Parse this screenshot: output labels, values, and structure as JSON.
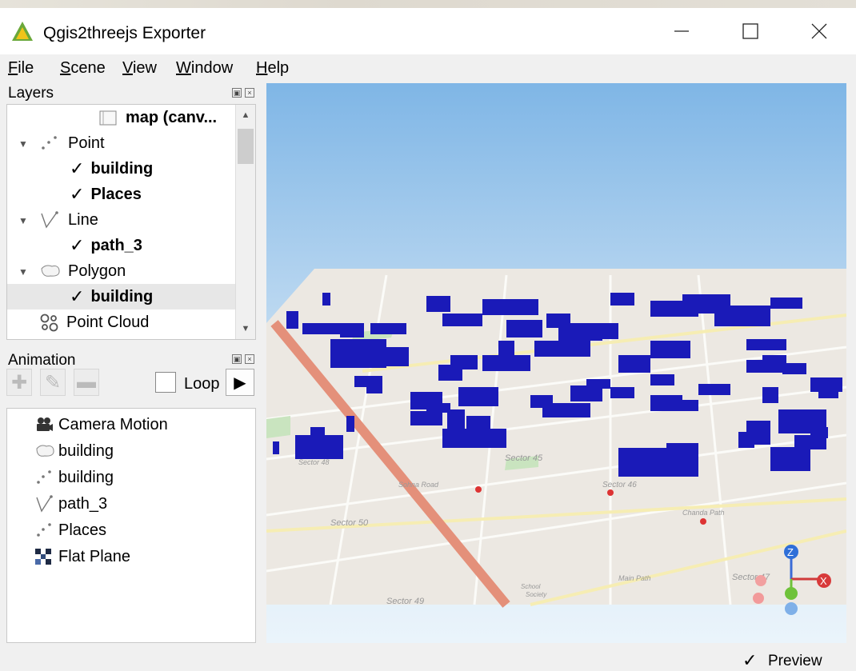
{
  "window": {
    "title": "Qgis2threejs Exporter",
    "minimize_icon": "minimize-icon",
    "maximize_icon": "maximize-icon",
    "close_icon": "close-icon"
  },
  "background_map_label": "Sector 37",
  "menu": {
    "file": {
      "accel": "F",
      "rest": "ile"
    },
    "scene": {
      "accel": "S",
      "rest": "cene"
    },
    "view": {
      "accel": "V",
      "rest": "iew"
    },
    "window": {
      "accel": "W",
      "rest": "indow"
    },
    "help": {
      "accel": "H",
      "rest": "elp"
    }
  },
  "layers_panel": {
    "title": "Layers",
    "float_icon": "float-icon",
    "close_icon": "close-icon",
    "items": [
      {
        "label": "map (canv...",
        "type": "map",
        "bold": true,
        "icon": "map-canvas-icon"
      },
      {
        "label": "Point",
        "type": "group",
        "icon": "point-group-icon",
        "expanded": true
      },
      {
        "label": "building",
        "type": "layer",
        "checked": true,
        "bold": true
      },
      {
        "label": "Places",
        "type": "layer",
        "checked": true,
        "bold": true
      },
      {
        "label": "Line",
        "type": "group",
        "icon": "line-group-icon",
        "expanded": true
      },
      {
        "label": "path_3",
        "type": "layer",
        "checked": true,
        "bold": true
      },
      {
        "label": "Polygon",
        "type": "group",
        "icon": "polygon-group-icon",
        "expanded": true
      },
      {
        "label": "building",
        "type": "layer",
        "checked": true,
        "bold": true,
        "selected": true
      },
      {
        "label": "Point Cloud",
        "type": "group",
        "icon": "point-cloud-icon"
      }
    ]
  },
  "animation_panel": {
    "title": "Animation",
    "loop_label": "Loop",
    "loop_checked": false,
    "items": [
      {
        "label": "Camera Motion",
        "icon": "camera-icon"
      },
      {
        "label": "building",
        "icon": "polygon-icon"
      },
      {
        "label": "building",
        "icon": "point-icon"
      },
      {
        "label": "path_3",
        "icon": "line-icon"
      },
      {
        "label": "Places",
        "icon": "point-icon"
      },
      {
        "label": "Flat Plane",
        "icon": "flat-plane-icon"
      }
    ]
  },
  "map_labels": {
    "s45": "Sector 45",
    "s46": "Sector 46",
    "s47": "Sector 47",
    "s48": "Sector 48",
    "s49": "Sector 49",
    "s50": "Sector 50",
    "sohna": "Sohna Road",
    "school": "School",
    "society": "Society",
    "chanda": "Chanda Path",
    "main": "Main Path"
  },
  "axes": {
    "z": "Z",
    "x": "X"
  },
  "colors": {
    "buildings": "#1a1ab8",
    "sky_top": "#7fb6e6",
    "sky_bottom": "#eaf4fb",
    "major_road": "#e4907a",
    "map_base": "#ece8e2"
  },
  "status": {
    "preview_label": "Preview",
    "preview_checked": true
  }
}
